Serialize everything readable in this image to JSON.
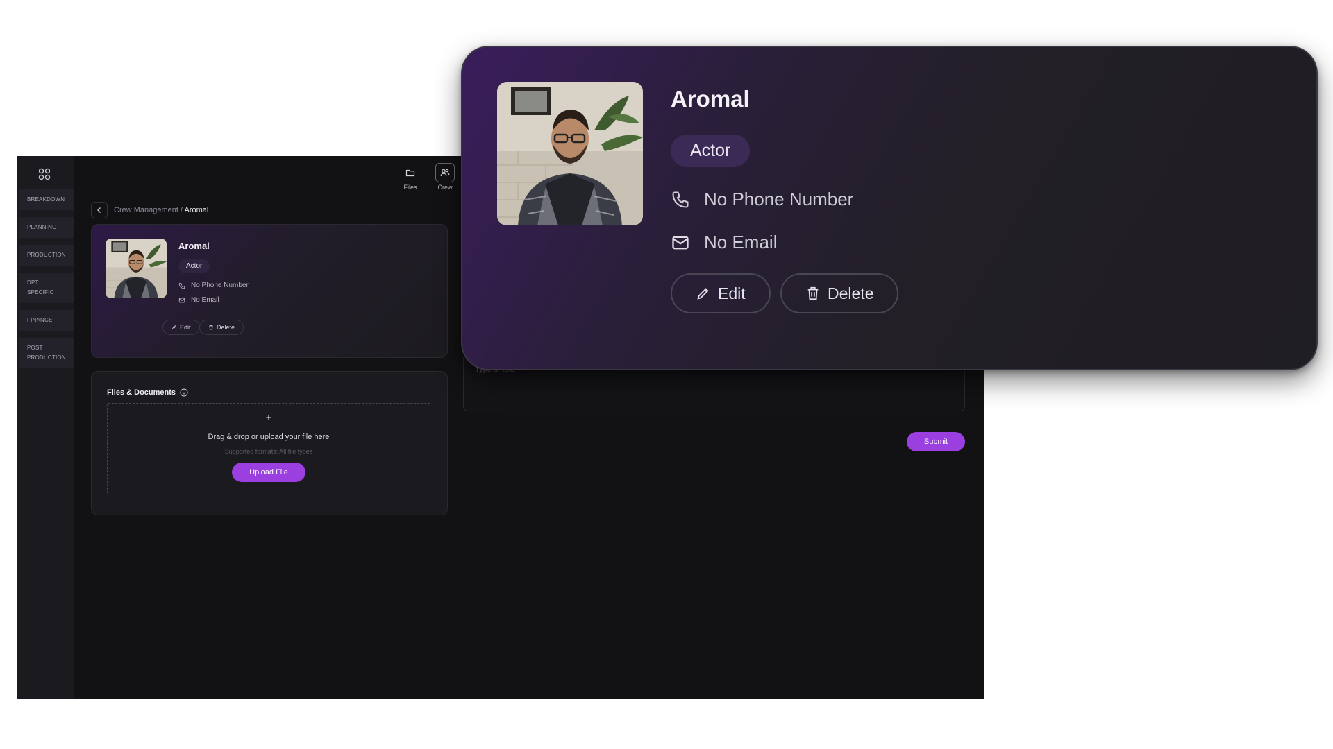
{
  "sidebar": {
    "items": [
      {
        "lines": [
          "BREAKDOWN"
        ]
      },
      {
        "lines": [
          "PLANNING"
        ]
      },
      {
        "lines": [
          "PRODUCTION"
        ]
      },
      {
        "lines": [
          "DPT",
          "SPECIFIC"
        ]
      },
      {
        "lines": [
          "FINANCE"
        ]
      },
      {
        "lines": [
          "POST",
          "PRODUCTION"
        ]
      }
    ]
  },
  "top_actions": [
    {
      "label": "Files",
      "icon": "folder-icon"
    },
    {
      "label": "Crew",
      "icon": "crew-icon",
      "active": true
    }
  ],
  "breadcrumb": {
    "parent": "Crew Management",
    "separator": "/",
    "current": "Aromal"
  },
  "profile": {
    "name": "Aromal",
    "role": "Actor",
    "phone": "No Phone Number",
    "email": "No Email",
    "edit_label": "Edit",
    "delete_label": "Delete"
  },
  "files": {
    "title": "Files & Documents",
    "plus": "+",
    "drop_text": "Drag & drop or upload your file here",
    "formats": "Supported formats: All file types",
    "upload_label": "Upload File"
  },
  "notes": {
    "placeholder": "Type a note",
    "submit_label": "Submit"
  },
  "colors": {
    "accent": "#9b3fe0",
    "background": "#121214",
    "sidebar": "#1b1a1f"
  }
}
